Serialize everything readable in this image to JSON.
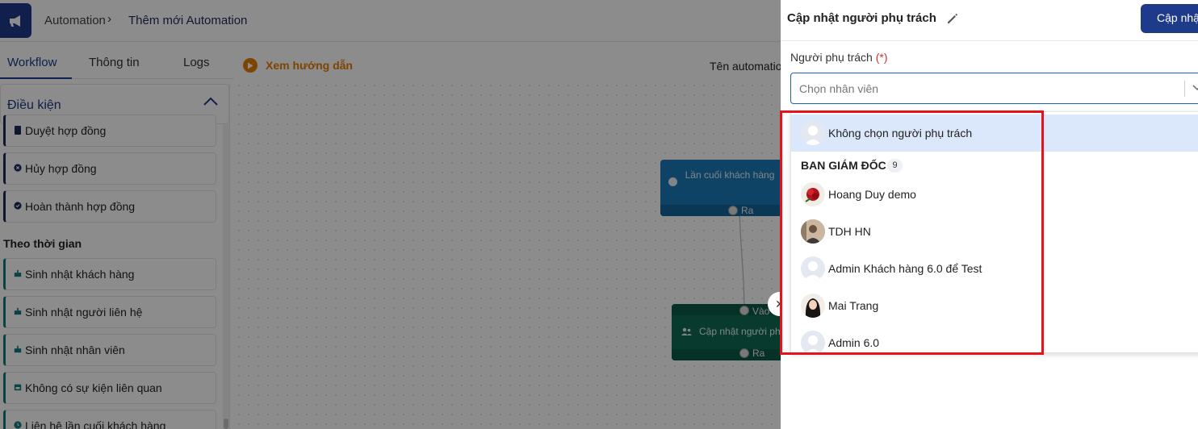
{
  "breadcrumb": {
    "parent": "Automation",
    "separator": "›",
    "current": "Thêm mới Automation"
  },
  "tabs": [
    {
      "label": "Workflow",
      "active": true
    },
    {
      "label": "Thông tin",
      "active": false
    },
    {
      "label": "Logs",
      "active": false
    }
  ],
  "sidebar": {
    "section_title": "Điều kiện",
    "items": [
      {
        "label": "Duyệt hợp đồng",
        "icon": "clipboard-icon"
      },
      {
        "label": "Hủy hợp đồng",
        "icon": "cancel-circle-icon"
      },
      {
        "label": "Hoàn thành hợp đồng",
        "icon": "check-circle-icon"
      }
    ],
    "time_section": "Theo thời gian",
    "time_items": [
      {
        "label": "Sinh nhật khách hàng",
        "icon": "cake-icon"
      },
      {
        "label": "Sinh nhật người liên hệ",
        "icon": "cake-icon"
      },
      {
        "label": "Sinh nhật nhân viên",
        "icon": "cake-icon"
      },
      {
        "label": "Không có sự kiện liên quan",
        "icon": "calendar-icon"
      },
      {
        "label": "Liên hệ lần cuối khách hàng",
        "icon": "clock-icon"
      }
    ]
  },
  "toolbar": {
    "guide_label": "Xem hướng dẫn",
    "name_label": "Tên automatio"
  },
  "canvas": {
    "node_trigger": {
      "text": "Lần cuối khách hàng",
      "out_label": "Ra"
    },
    "node_action": {
      "in_label": "Vào",
      "text": "Cập nhật người phụ",
      "out_label": "Ra"
    }
  },
  "drawer": {
    "title": "Cập nhật người phụ trách",
    "submit_label": "Cập nhậ",
    "field_label": "Người phụ trách",
    "required_mark": "(*)",
    "select_placeholder": "Chọn nhân viên",
    "options": {
      "none_option": "Không chọn người phụ trách",
      "group": {
        "name": "BAN GIÁM ĐỐC",
        "count": "9"
      },
      "people": [
        {
          "name": "Hoang Duy demo",
          "avatar": "rose-avatar"
        },
        {
          "name": "TDH HN",
          "avatar": "photo-avatar"
        },
        {
          "name": "Admin Khách hàng 6.0 để Test",
          "avatar": "default-avatar"
        },
        {
          "name": "Mai Trang",
          "avatar": "photo-avatar"
        },
        {
          "name": "Admin 6.0",
          "avatar": "default-avatar"
        }
      ]
    }
  },
  "colors": {
    "primary": "#1e3a8a",
    "accent_orange": "#e67e00",
    "highlight_red": "#e5141b",
    "selected_bg": "#dbe7fa"
  }
}
